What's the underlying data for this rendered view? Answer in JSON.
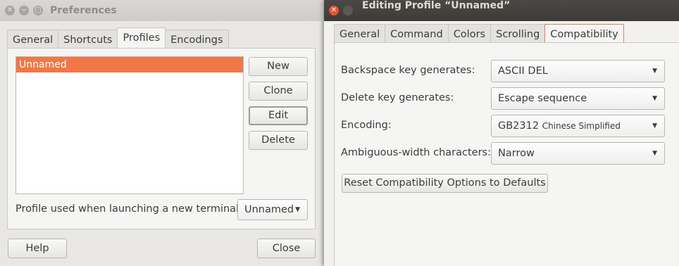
{
  "preferences": {
    "title": "Preferences",
    "tabs": [
      "General",
      "Shortcuts",
      "Profiles",
      "Encodings"
    ],
    "profiles": [
      "Unnamed"
    ],
    "buttons": {
      "new": "New",
      "clone": "Clone",
      "edit": "Edit",
      "delete": "Delete"
    },
    "launch_label": "Profile used when launching a new terminal:",
    "launch_value": "Unnamed",
    "help": "Help",
    "close": "Close"
  },
  "profile_editor": {
    "title": "Editing Profile “Unnamed”",
    "tabs": [
      "General",
      "Command",
      "Colors",
      "Scrolling",
      "Compatibility"
    ],
    "rows": [
      {
        "label": "Backspace key generates:",
        "value": "ASCII DEL",
        "value_note": ""
      },
      {
        "label": "Delete key generates:",
        "value": "Escape sequence",
        "value_note": ""
      },
      {
        "label": "Encoding:",
        "value": "GB2312",
        "value_note": "Chinese Simplified"
      },
      {
        "label": "Ambiguous-width characters:",
        "value": "Narrow",
        "value_note": ""
      }
    ],
    "reset_button": "Reset Compatibility Options to Defaults"
  },
  "icons": {
    "close": "close-icon",
    "minimize": "minimize-icon",
    "maximize": "maximize-icon",
    "dropdown": "chevron-down-icon"
  },
  "colors": {
    "accent": "#f07746",
    "close_button": "#e4572e"
  }
}
